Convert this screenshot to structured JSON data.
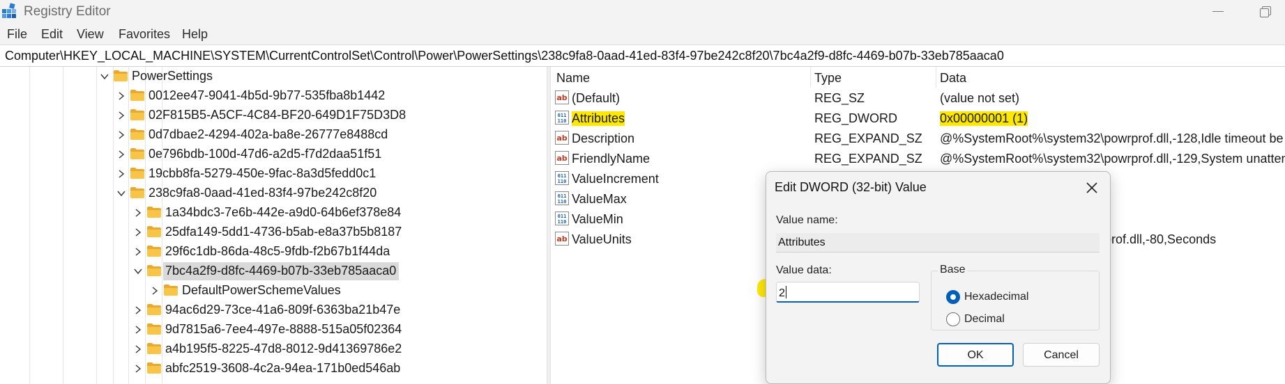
{
  "window": {
    "title": "Registry Editor"
  },
  "menu": [
    "File",
    "Edit",
    "View",
    "Favorites",
    "Help"
  ],
  "address": "Computer\\HKEY_LOCAL_MACHINE\\SYSTEM\\CurrentControlSet\\Control\\Power\\PowerSettings\\238c9fa8-0aad-41ed-83f4-97be242c8f20\\7bc4a2f9-d8fc-4469-b07b-33eb785aaca0",
  "tree": {
    "items": [
      {
        "label": "PowerSettings",
        "expanded": true
      },
      {
        "label": "0012ee47-9041-4b5d-9b77-535fba8b1442",
        "expanded": false
      },
      {
        "label": "02F815B5-A5CF-4C84-BF20-649D1F75D3D8",
        "expanded": false
      },
      {
        "label": "0d7dbae2-4294-402a-ba8e-26777e8488cd",
        "expanded": false
      },
      {
        "label": "0e796bdb-100d-47d6-a2d5-f7d2daa51f51",
        "expanded": false
      },
      {
        "label": "19cbb8fa-5279-450e-9fac-8a3d5fedd0c1",
        "expanded": false
      },
      {
        "label": "238c9fa8-0aad-41ed-83f4-97be242c8f20",
        "expanded": true
      },
      {
        "label": "1a34bdc3-7e6b-442e-a9d0-64b6ef378e84",
        "expanded": false
      },
      {
        "label": "25dfa149-5dd1-4736-b5ab-e8a37b5b8187",
        "expanded": false
      },
      {
        "label": "29f6c1db-86da-48c5-9fdb-f2b67b1f44da",
        "expanded": false
      },
      {
        "label": "7bc4a2f9-d8fc-4469-b07b-33eb785aaca0",
        "expanded": true,
        "selected": true
      },
      {
        "label": "DefaultPowerSchemeValues",
        "expanded": false
      },
      {
        "label": "94ac6d29-73ce-41a6-809f-6363ba21b47e",
        "expanded": false
      },
      {
        "label": "9d7815a6-7ee4-497e-8888-515a05f02364",
        "expanded": false
      },
      {
        "label": "a4b195f5-8225-47d8-8012-9d41369786e2",
        "expanded": false
      },
      {
        "label": "abfc2519-3608-4c2a-94ea-171b0ed546ab",
        "expanded": false
      }
    ]
  },
  "list": {
    "headers": {
      "name": "Name",
      "type": "Type",
      "data": "Data"
    },
    "rows": [
      {
        "icon": "string-value-icon",
        "name": "(Default)",
        "type": "REG_SZ",
        "data": "(value not set)"
      },
      {
        "icon": "dword-value-icon",
        "name": "Attributes",
        "type": "REG_DWORD",
        "data": "0x00000001 (1)",
        "highlighted": true
      },
      {
        "icon": "string-value-icon",
        "name": "Description",
        "type": "REG_EXPAND_SZ",
        "data": "@%SystemRoot%\\system32\\powrprof.dll,-128,Idle timeout be"
      },
      {
        "icon": "string-value-icon",
        "name": "FriendlyName",
        "type": "REG_EXPAND_SZ",
        "data": "@%SystemRoot%\\system32\\powrprof.dll,-129,System unatten"
      },
      {
        "icon": "dword-value-icon",
        "name": "ValueIncrement",
        "type": "",
        "data": ""
      },
      {
        "icon": "dword-value-icon",
        "name": "ValueMax",
        "type": "",
        "data": ""
      },
      {
        "icon": "dword-value-icon",
        "name": "ValueMin",
        "type": "",
        "data": ""
      },
      {
        "icon": "string-value-icon",
        "name": "ValueUnits",
        "type": "",
        "data": "owrprof.dll,-80,Seconds"
      }
    ]
  },
  "dialog": {
    "title": "Edit DWORD (32-bit) Value",
    "value_name_label": "Value name:",
    "value_name": "Attributes",
    "value_data_label": "Value data:",
    "value_data": "2",
    "base_label": "Base",
    "base_options": [
      "Hexadecimal",
      "Decimal"
    ],
    "base_selected": "Hexadecimal",
    "ok_label": "OK",
    "cancel_label": "Cancel"
  },
  "colors": {
    "highlight": "#ffe800",
    "folder": "#f8c548",
    "accent": "#005fb8"
  }
}
